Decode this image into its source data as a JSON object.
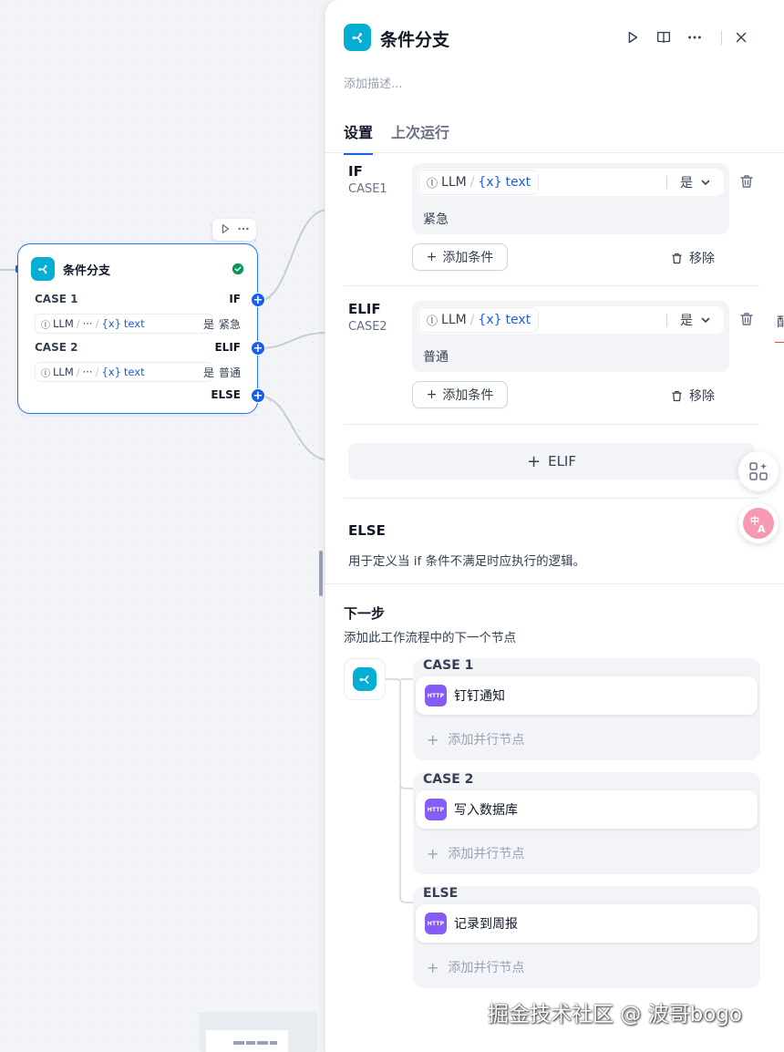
{
  "canvas": {
    "node": {
      "title": "条件分支",
      "cases": [
        {
          "label": "CASE 1",
          "tag": "IF",
          "var_node": "LLM",
          "ellipsis": "···",
          "var_name": "text",
          "operator": "是",
          "value": "紧急"
        },
        {
          "label": "CASE 2",
          "tag": "ELIF",
          "var_node": "LLM",
          "ellipsis": "···",
          "var_name": "text",
          "operator": "是",
          "value": "普通"
        }
      ],
      "else_tag": "ELSE",
      "toolbar_icons": [
        "play-icon",
        "more-icon"
      ]
    }
  },
  "panel": {
    "title": "条件分支",
    "description_placeholder": "添加描述...",
    "header_icons": [
      "play-icon",
      "book-icon",
      "more-icon",
      "close-icon"
    ],
    "tabs": [
      {
        "label": "设置",
        "active": true
      },
      {
        "label": "上次运行",
        "active": false
      }
    ],
    "cases": [
      {
        "keyword": "IF",
        "sub": "CASE1",
        "var_node": "LLM",
        "var_name": "text",
        "operator": "是",
        "value": "紧急",
        "add_condition": "添加条件",
        "remove": "移除"
      },
      {
        "keyword": "ELIF",
        "sub": "CASE2",
        "var_node": "LLM",
        "var_name": "text",
        "operator": "是",
        "value": "普通",
        "add_condition": "添加条件",
        "remove": "移除"
      }
    ],
    "elif_button": "ELIF",
    "else": {
      "title": "ELSE",
      "description": "用于定义当 if 条件不满足时应执行的逻辑。"
    },
    "next_step": {
      "title": "下一步",
      "description": "添加此工作流程中的下一个节点",
      "branches": [
        {
          "label": "CASE 1",
          "node_icon": "HTTP",
          "node_name": "钉钉通知",
          "add_parallel": "添加并行节点"
        },
        {
          "label": "CASE 2",
          "node_icon": "HTTP",
          "node_name": "写入数据库",
          "add_parallel": "添加并行节点"
        },
        {
          "label": "ELSE",
          "node_icon": "HTTP",
          "node_name": "记录到周报",
          "add_parallel": "添加并行节点"
        }
      ]
    }
  },
  "cut_off_text": "配",
  "watermark": "掘金技术社区 @ 波哥bogo",
  "colors": {
    "accent": "#155eef",
    "node_icon": "#06aed4",
    "http_icon": "#875bf7",
    "success": "#039855"
  }
}
